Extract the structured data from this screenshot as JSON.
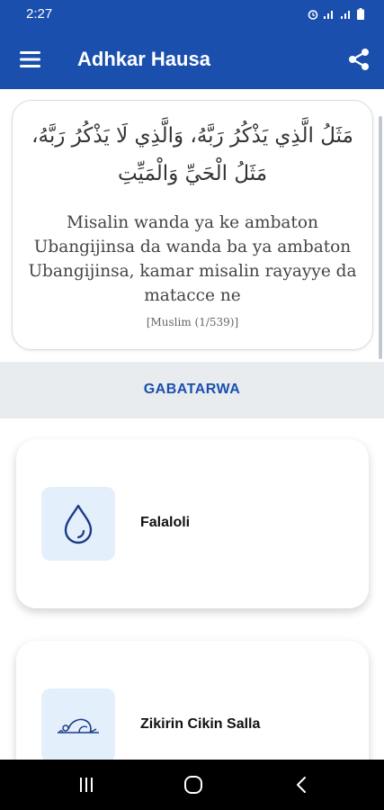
{
  "status_bar": {
    "time": "2:27"
  },
  "app_bar": {
    "title": "Adhkar Hausa"
  },
  "quote": {
    "arabic": "مَثَلُ الَّذِي يَذْكُرُ رَبَّهُ، وَالَّذِي لَا يَذْكُرُ رَبَّهُ، مَثَلُ الْحَيِّ وَالْمَيِّتِ",
    "hausa": "Misalin wanda ya ke ambaton Ubangijinsa da wanda ba ya ambaton Ubangijinsa, kamar misalin rayayye da matacce ne",
    "reference": "[Muslim (1/539)]"
  },
  "section": {
    "label": "GABATARWA"
  },
  "items": [
    {
      "label": "Falaloli",
      "icon": "water-drop-icon"
    },
    {
      "label": "Zikirin Cikin Salla",
      "icon": "prostration-icon"
    }
  ],
  "colors": {
    "primary": "#1a4fae",
    "tile": "#e4effc",
    "section_bg": "#e9ecef"
  }
}
